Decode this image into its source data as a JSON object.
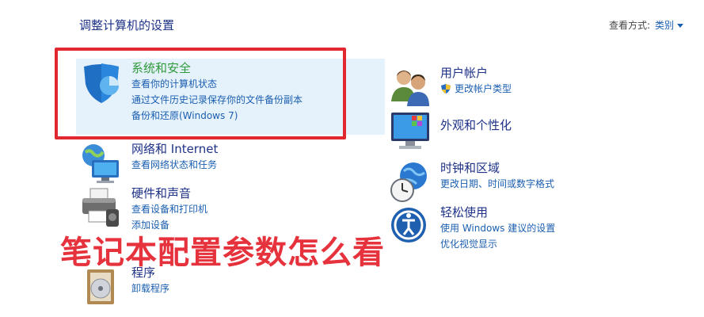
{
  "header": {
    "title": "调整计算机的设置",
    "view_by_label": "查看方式:",
    "view_by_value": "类别"
  },
  "left": [
    {
      "title": "系统和安全",
      "links": [
        "查看你的计算机状态",
        "通过文件历史记录保存你的文件备份副本",
        "备份和还原(Windows 7)"
      ]
    },
    {
      "title": "网络和 Internet",
      "links": [
        "查看网络状态和任务"
      ]
    },
    {
      "title": "硬件和声音",
      "links": [
        "查看设备和打印机",
        "添加设备"
      ]
    },
    {
      "title": "程序",
      "links": [
        "卸载程序"
      ]
    }
  ],
  "right": [
    {
      "title": "用户帐户",
      "links": [
        "更改帐户类型"
      ]
    },
    {
      "title": "外观和个性化",
      "links": []
    },
    {
      "title": "时钟和区域",
      "links": [
        "更改日期、时间或数字格式"
      ]
    },
    {
      "title": "轻松使用",
      "links": [
        "使用 Windows 建议的设置",
        "优化视觉显示"
      ]
    }
  ],
  "overlay_caption": "笔记本配置参数怎么看",
  "colors": {
    "title_blue": "#1e3287",
    "link_blue": "#1b5fb0",
    "highlight_green": "#2f9a3a",
    "callout_red": "#e0282e"
  },
  "icons": [
    "shield-icon",
    "network-icon",
    "printer-icon",
    "programs-icon",
    "users-icon",
    "appearance-icon",
    "clock-globe-icon",
    "ease-of-access-icon",
    "uac-shield-icon"
  ]
}
